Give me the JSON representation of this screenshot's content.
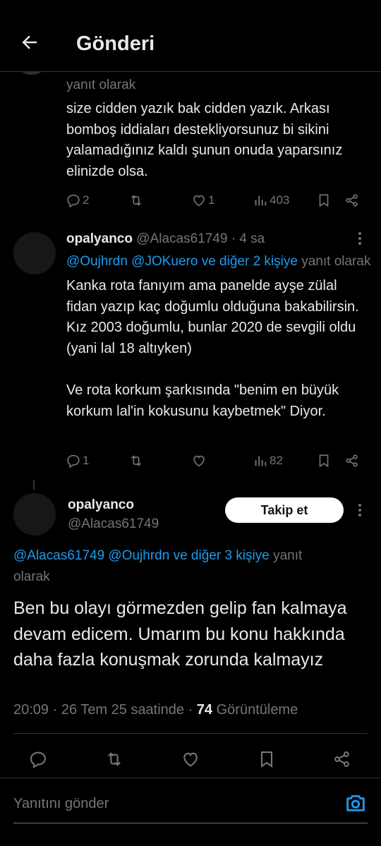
{
  "header": {
    "title": "Gönderi",
    "back_icon": "arrow-left-icon"
  },
  "tweets": [
    {
      "reply_context": "yanıt olarak",
      "body": "size cidden yazık bak cidden yazık. Arkası bomboş iddiaları destekliyorsunuz bi sikini yalamadığınız kaldı şunun onuda yaparsınız elinizde olsa.",
      "stats": {
        "replies": "2",
        "retweets": "",
        "likes": "1",
        "views": "403"
      }
    },
    {
      "name": "opalyanco",
      "handle_time": "@Alacas61749 · 4 sa",
      "reply_links": "@Oujhrdn @JOKuero ve diğer 2 kişiye",
      "reply_suffix": "yanıt olarak",
      "body": "Kanka rota fanıyım ama panelde ayşe zülal fidan yazıp kaç doğumlu olduğuna bakabilirsin. Kız 2003 doğumlu, bunlar 2020 de sevgili oldu (yani lal 18 altıyken)",
      "body2": "Ve rota korkum şarkısında \"benim en büyük korkum lal'in kokusunu kaybetmek\" Diyor.",
      "stats": {
        "replies": "1",
        "retweets": "",
        "likes": "",
        "views": "82"
      }
    }
  ],
  "main_tweet": {
    "name": "opalyanco",
    "handle": "@Alacas61749",
    "follow_label": "Takip et",
    "reply_links": "@Alacas61749 @Oujhrdn ve diğer 3 kişiye",
    "reply_suffix": "yanıt",
    "reply_suffix2": "olarak",
    "body": "Ben bu olayı görmezden gelip fan kalmaya devam edicem. Umarım bu konu hakkında daha fazla konuşmak zorunda kalmayız",
    "time": "20:09 · 26 Tem 25 saatinde · ",
    "views_count": "74",
    "views_label": " Görüntüleme"
  },
  "reply_bar": {
    "placeholder": "Yanıtını gönder",
    "camera_icon": "camera-icon"
  },
  "colors": {
    "background": "#000000",
    "text": "#e7e9ea",
    "muted": "#71767b",
    "link": "#1d9bf0",
    "divider": "#2f3336"
  }
}
